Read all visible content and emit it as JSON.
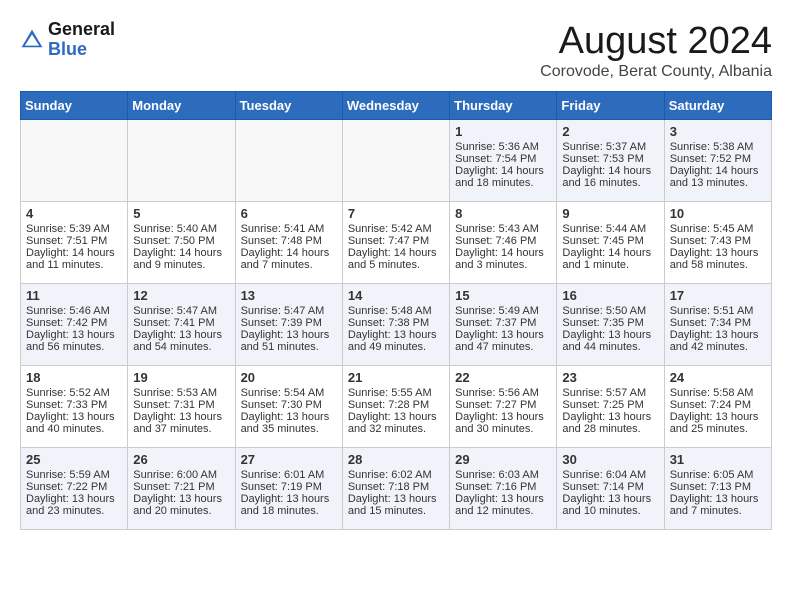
{
  "header": {
    "logo_general": "General",
    "logo_blue": "Blue",
    "month": "August 2024",
    "location": "Corovode, Berat County, Albania"
  },
  "days_of_week": [
    "Sunday",
    "Monday",
    "Tuesday",
    "Wednesday",
    "Thursday",
    "Friday",
    "Saturday"
  ],
  "weeks": [
    [
      {
        "day": "",
        "info": ""
      },
      {
        "day": "",
        "info": ""
      },
      {
        "day": "",
        "info": ""
      },
      {
        "day": "",
        "info": ""
      },
      {
        "day": "1",
        "info": "Sunrise: 5:36 AM\nSunset: 7:54 PM\nDaylight: 14 hours\nand 18 minutes."
      },
      {
        "day": "2",
        "info": "Sunrise: 5:37 AM\nSunset: 7:53 PM\nDaylight: 14 hours\nand 16 minutes."
      },
      {
        "day": "3",
        "info": "Sunrise: 5:38 AM\nSunset: 7:52 PM\nDaylight: 14 hours\nand 13 minutes."
      }
    ],
    [
      {
        "day": "4",
        "info": "Sunrise: 5:39 AM\nSunset: 7:51 PM\nDaylight: 14 hours\nand 11 minutes."
      },
      {
        "day": "5",
        "info": "Sunrise: 5:40 AM\nSunset: 7:50 PM\nDaylight: 14 hours\nand 9 minutes."
      },
      {
        "day": "6",
        "info": "Sunrise: 5:41 AM\nSunset: 7:48 PM\nDaylight: 14 hours\nand 7 minutes."
      },
      {
        "day": "7",
        "info": "Sunrise: 5:42 AM\nSunset: 7:47 PM\nDaylight: 14 hours\nand 5 minutes."
      },
      {
        "day": "8",
        "info": "Sunrise: 5:43 AM\nSunset: 7:46 PM\nDaylight: 14 hours\nand 3 minutes."
      },
      {
        "day": "9",
        "info": "Sunrise: 5:44 AM\nSunset: 7:45 PM\nDaylight: 14 hours\nand 1 minute."
      },
      {
        "day": "10",
        "info": "Sunrise: 5:45 AM\nSunset: 7:43 PM\nDaylight: 13 hours\nand 58 minutes."
      }
    ],
    [
      {
        "day": "11",
        "info": "Sunrise: 5:46 AM\nSunset: 7:42 PM\nDaylight: 13 hours\nand 56 minutes."
      },
      {
        "day": "12",
        "info": "Sunrise: 5:47 AM\nSunset: 7:41 PM\nDaylight: 13 hours\nand 54 minutes."
      },
      {
        "day": "13",
        "info": "Sunrise: 5:47 AM\nSunset: 7:39 PM\nDaylight: 13 hours\nand 51 minutes."
      },
      {
        "day": "14",
        "info": "Sunrise: 5:48 AM\nSunset: 7:38 PM\nDaylight: 13 hours\nand 49 minutes."
      },
      {
        "day": "15",
        "info": "Sunrise: 5:49 AM\nSunset: 7:37 PM\nDaylight: 13 hours\nand 47 minutes."
      },
      {
        "day": "16",
        "info": "Sunrise: 5:50 AM\nSunset: 7:35 PM\nDaylight: 13 hours\nand 44 minutes."
      },
      {
        "day": "17",
        "info": "Sunrise: 5:51 AM\nSunset: 7:34 PM\nDaylight: 13 hours\nand 42 minutes."
      }
    ],
    [
      {
        "day": "18",
        "info": "Sunrise: 5:52 AM\nSunset: 7:33 PM\nDaylight: 13 hours\nand 40 minutes."
      },
      {
        "day": "19",
        "info": "Sunrise: 5:53 AM\nSunset: 7:31 PM\nDaylight: 13 hours\nand 37 minutes."
      },
      {
        "day": "20",
        "info": "Sunrise: 5:54 AM\nSunset: 7:30 PM\nDaylight: 13 hours\nand 35 minutes."
      },
      {
        "day": "21",
        "info": "Sunrise: 5:55 AM\nSunset: 7:28 PM\nDaylight: 13 hours\nand 32 minutes."
      },
      {
        "day": "22",
        "info": "Sunrise: 5:56 AM\nSunset: 7:27 PM\nDaylight: 13 hours\nand 30 minutes."
      },
      {
        "day": "23",
        "info": "Sunrise: 5:57 AM\nSunset: 7:25 PM\nDaylight: 13 hours\nand 28 minutes."
      },
      {
        "day": "24",
        "info": "Sunrise: 5:58 AM\nSunset: 7:24 PM\nDaylight: 13 hours\nand 25 minutes."
      }
    ],
    [
      {
        "day": "25",
        "info": "Sunrise: 5:59 AM\nSunset: 7:22 PM\nDaylight: 13 hours\nand 23 minutes."
      },
      {
        "day": "26",
        "info": "Sunrise: 6:00 AM\nSunset: 7:21 PM\nDaylight: 13 hours\nand 20 minutes."
      },
      {
        "day": "27",
        "info": "Sunrise: 6:01 AM\nSunset: 7:19 PM\nDaylight: 13 hours\nand 18 minutes."
      },
      {
        "day": "28",
        "info": "Sunrise: 6:02 AM\nSunset: 7:18 PM\nDaylight: 13 hours\nand 15 minutes."
      },
      {
        "day": "29",
        "info": "Sunrise: 6:03 AM\nSunset: 7:16 PM\nDaylight: 13 hours\nand 12 minutes."
      },
      {
        "day": "30",
        "info": "Sunrise: 6:04 AM\nSunset: 7:14 PM\nDaylight: 13 hours\nand 10 minutes."
      },
      {
        "day": "31",
        "info": "Sunrise: 6:05 AM\nSunset: 7:13 PM\nDaylight: 13 hours\nand 7 minutes."
      }
    ]
  ]
}
